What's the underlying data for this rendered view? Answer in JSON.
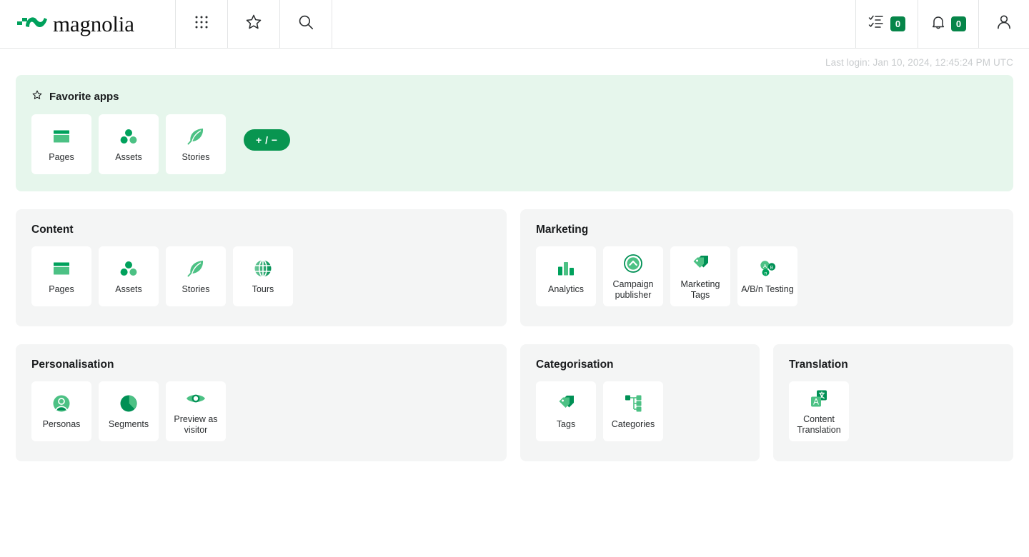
{
  "header": {
    "logo_text": "magnolia",
    "logo_icon": "magnolia-wave-logo",
    "apps_icon": "grid-dots-icon",
    "favorites_icon": "star-outline-icon",
    "search_icon": "search-icon",
    "tasks_icon": "tasks-checklist-icon",
    "tasks_count": "0",
    "notifications_icon": "bell-icon",
    "notifications_count": "0",
    "user_icon": "user-avatar-icon"
  },
  "status": {
    "last_login": "Last login: Jan 10, 2024, 12:45:24 PM UTC"
  },
  "favorites": {
    "title": "Favorite apps",
    "star_icon": "star-outline-icon",
    "edit_button": "+ / −",
    "apps": [
      {
        "label": "Pages",
        "icon": "pages-icon"
      },
      {
        "label": "Assets",
        "icon": "assets-icon"
      },
      {
        "label": "Stories",
        "icon": "stories-feather-icon"
      }
    ]
  },
  "groups": [
    {
      "title": "Content",
      "apps": [
        {
          "label": "Pages",
          "icon": "pages-icon"
        },
        {
          "label": "Assets",
          "icon": "assets-icon"
        },
        {
          "label": "Stories",
          "icon": "stories-feather-icon"
        },
        {
          "label": "Tours",
          "icon": "globe-icon"
        }
      ]
    },
    {
      "title": "Marketing",
      "apps": [
        {
          "label": "Analytics",
          "icon": "bar-chart-icon"
        },
        {
          "label": "Campaign publisher",
          "icon": "campaign-publish-icon"
        },
        {
          "label": "Marketing Tags",
          "icon": "marketing-tags-icon"
        },
        {
          "label": "A/B/n Testing",
          "icon": "abn-testing-icon"
        }
      ]
    },
    {
      "title": "Personalisation",
      "apps": [
        {
          "label": "Personas",
          "icon": "persona-avatar-icon"
        },
        {
          "label": "Segments",
          "icon": "pie-chart-icon"
        },
        {
          "label": "Preview as visitor",
          "icon": "eye-icon"
        }
      ]
    },
    {
      "title": "Categorisation",
      "apps": [
        {
          "label": "Tags",
          "icon": "tag-icon"
        },
        {
          "label": "Categories",
          "icon": "tree-hierarchy-icon"
        }
      ]
    },
    {
      "title": "Translation",
      "apps": [
        {
          "label": "Content Translation",
          "icon": "content-translation-icon"
        }
      ]
    }
  ],
  "colors": {
    "brand_green": "#089550",
    "dark_green": "#00a15c",
    "light_green": "#4cc184",
    "fav_panel_bg": "#e6f6ec",
    "panel_bg": "#f4f5f5"
  }
}
